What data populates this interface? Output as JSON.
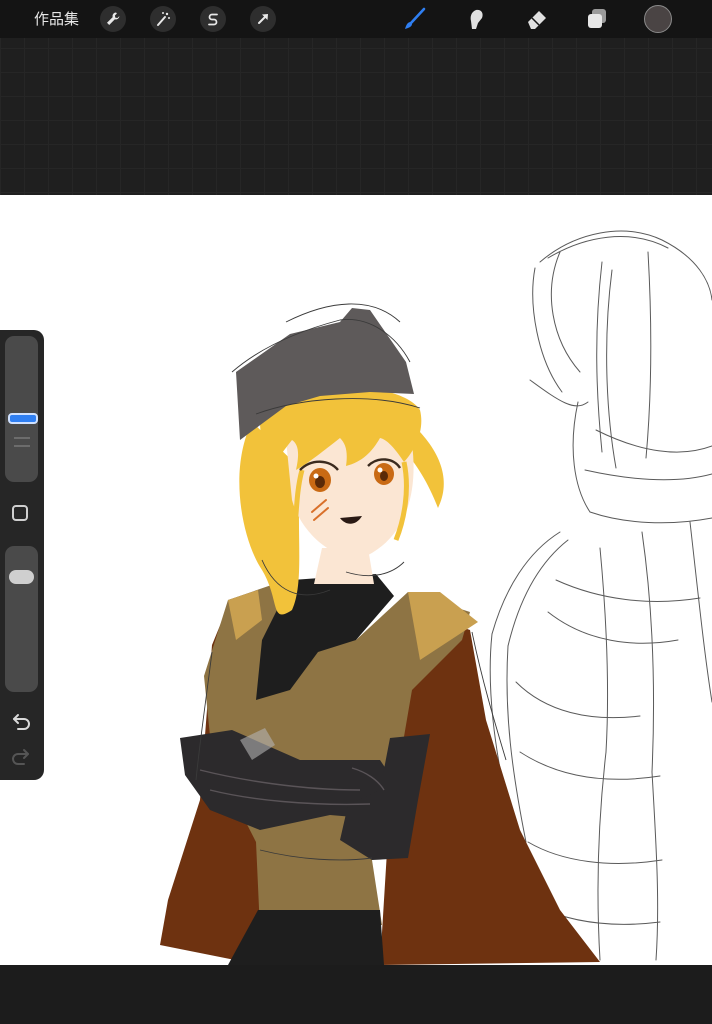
{
  "topbar": {
    "gallery_label": "作品集",
    "left_tools": [
      {
        "name": "actions",
        "icon": "wrench-icon"
      },
      {
        "name": "adjustments",
        "icon": "magic-wand-icon"
      },
      {
        "name": "selection",
        "icon": "selection-s-icon"
      },
      {
        "name": "transform",
        "icon": "arrow-cursor-icon"
      }
    ],
    "right_tools": [
      {
        "name": "brush",
        "icon": "brush-icon",
        "active": true
      },
      {
        "name": "smudge",
        "icon": "smudge-finger-icon",
        "active": false
      },
      {
        "name": "eraser",
        "icon": "eraser-icon",
        "active": false
      },
      {
        "name": "layers",
        "icon": "layers-icon",
        "active": false
      }
    ],
    "current_color": "#4a4444"
  },
  "colors": {
    "accent": "#2f7ff2",
    "canvas": "#ffffff",
    "hair": "#f2c23a",
    "hat": "#5e5a5a",
    "cloak": "#6e3210",
    "vest": "#8e7444",
    "inner": "#1e1e1e",
    "eyes": "#c96a14",
    "sketch": "#5a5a5a"
  },
  "sidebar": {
    "brush_size": 0.45,
    "brush_opacity": 0.85,
    "modify_icon": "square-outline-icon",
    "undo_icon": "undo-icon",
    "redo_icon": "redo-icon",
    "redo_enabled": false
  }
}
